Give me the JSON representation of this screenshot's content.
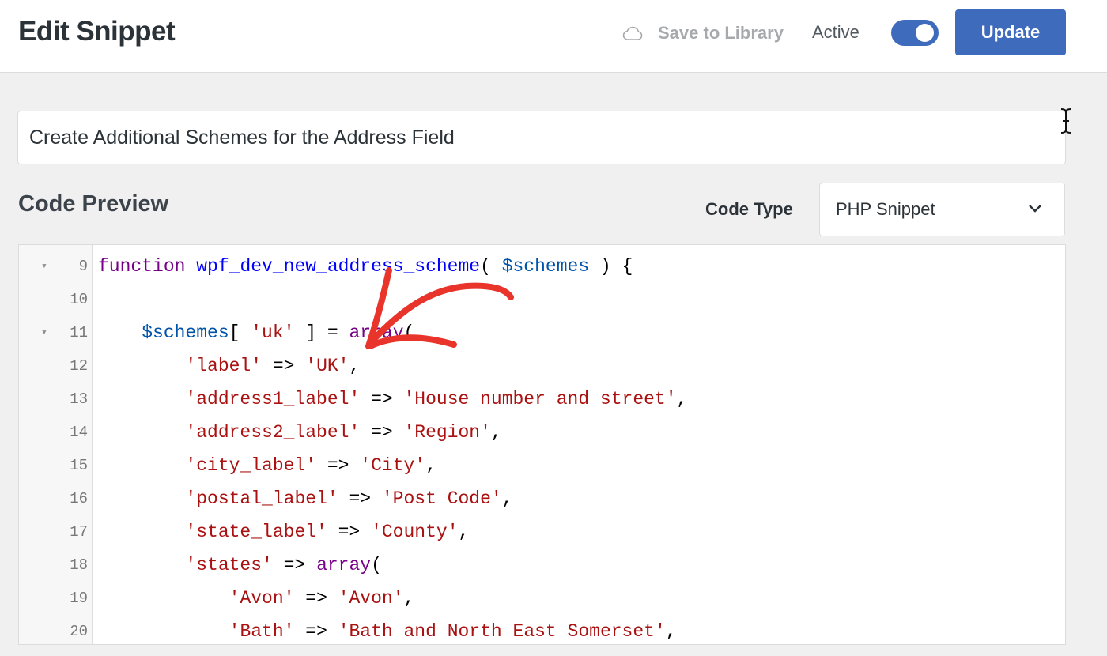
{
  "header": {
    "title": "Edit Snippet",
    "save_to_library": "Save to Library",
    "active_label": "Active",
    "active_on": true,
    "update_label": "Update"
  },
  "snippet": {
    "title_value": "Create Additional Schemes for the Address Field"
  },
  "code_preview": {
    "heading": "Code Preview",
    "code_type_label": "Code Type",
    "code_type_value": "PHP Snippet",
    "lines": [
      {
        "num": "9",
        "fold": "▾",
        "tokens": [
          [
            "kw",
            "function"
          ],
          [
            "plain",
            " "
          ],
          [
            "def",
            "wpf_dev_new_address_scheme"
          ],
          [
            "plain",
            "( "
          ],
          [
            "var",
            "$schemes"
          ],
          [
            "plain",
            " ) {"
          ]
        ]
      },
      {
        "num": "10",
        "fold": "",
        "tokens": []
      },
      {
        "num": "11",
        "fold": "▾",
        "tokens": [
          [
            "plain",
            "    "
          ],
          [
            "var",
            "$schemes"
          ],
          [
            "plain",
            "[ "
          ],
          [
            "str",
            "'uk'"
          ],
          [
            "plain",
            " ] = "
          ],
          [
            "kw",
            "array"
          ],
          [
            "plain",
            "("
          ]
        ]
      },
      {
        "num": "12",
        "fold": "",
        "tokens": [
          [
            "plain",
            "        "
          ],
          [
            "str",
            "'label'"
          ],
          [
            "plain",
            " => "
          ],
          [
            "str",
            "'UK'"
          ],
          [
            "plain",
            ","
          ]
        ]
      },
      {
        "num": "13",
        "fold": "",
        "tokens": [
          [
            "plain",
            "        "
          ],
          [
            "str",
            "'address1_label'"
          ],
          [
            "plain",
            " => "
          ],
          [
            "str",
            "'House number and street'"
          ],
          [
            "plain",
            ","
          ]
        ]
      },
      {
        "num": "14",
        "fold": "",
        "tokens": [
          [
            "plain",
            "        "
          ],
          [
            "str",
            "'address2_label'"
          ],
          [
            "plain",
            " => "
          ],
          [
            "str",
            "'Region'"
          ],
          [
            "plain",
            ","
          ]
        ]
      },
      {
        "num": "15",
        "fold": "",
        "tokens": [
          [
            "plain",
            "        "
          ],
          [
            "str",
            "'city_label'"
          ],
          [
            "plain",
            " => "
          ],
          [
            "str",
            "'City'"
          ],
          [
            "plain",
            ","
          ]
        ]
      },
      {
        "num": "16",
        "fold": "",
        "tokens": [
          [
            "plain",
            "        "
          ],
          [
            "str",
            "'postal_label'"
          ],
          [
            "plain",
            " => "
          ],
          [
            "str",
            "'Post Code'"
          ],
          [
            "plain",
            ","
          ]
        ]
      },
      {
        "num": "17",
        "fold": "",
        "tokens": [
          [
            "plain",
            "        "
          ],
          [
            "str",
            "'state_label'"
          ],
          [
            "plain",
            " => "
          ],
          [
            "str",
            "'County'"
          ],
          [
            "plain",
            ","
          ]
        ]
      },
      {
        "num": "18",
        "fold": "",
        "tokens": [
          [
            "plain",
            "        "
          ],
          [
            "str",
            "'states'"
          ],
          [
            "plain",
            " => "
          ],
          [
            "kw",
            "array"
          ],
          [
            "plain",
            "("
          ]
        ]
      },
      {
        "num": "19",
        "fold": "",
        "tokens": [
          [
            "plain",
            "            "
          ],
          [
            "str",
            "'Avon'"
          ],
          [
            "plain",
            " => "
          ],
          [
            "str",
            "'Avon'"
          ],
          [
            "plain",
            ","
          ]
        ]
      },
      {
        "num": "20",
        "fold": "",
        "tokens": [
          [
            "plain",
            "            "
          ],
          [
            "str",
            "'Bath'"
          ],
          [
            "plain",
            " => "
          ],
          [
            "str",
            "'Bath and North East Somerset'"
          ],
          [
            "plain",
            ","
          ]
        ]
      }
    ]
  },
  "colors": {
    "accent": "#3f6bbd",
    "annotation_arrow": "#e8342a"
  },
  "icons": {
    "save_to_library": "cloud-icon",
    "code_type": "chevron-down-icon",
    "mouse_cursor": "text-cursor-icon",
    "annotation": "arrow-annotation-icon"
  }
}
